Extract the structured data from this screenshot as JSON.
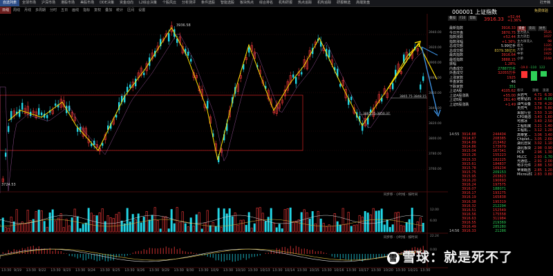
{
  "topbar": {
    "tabs": [
      "自选列表",
      "全球市场",
      "沪深市场",
      "港股市场",
      "美股市场",
      "DDE决策",
      "资金动向",
      "L2综合决策",
      "个股风云",
      "分析测评",
      "条件选股",
      "智能选股",
      "板块热点",
      "综合排名",
      "机构研报",
      "热点追踪",
      "机构追踪",
      "研报精选",
      "高端复盘"
    ],
    "active": 0,
    "open_label": "打开档"
  },
  "toolbar": {
    "items": [
      "日线",
      "周线",
      "月线",
      "多周期",
      "分时",
      "五日",
      "画线",
      "指标",
      "复权",
      "叠加",
      "统计",
      "区间",
      "设置"
    ],
    "selected": 0,
    "right_label": "设置"
  },
  "chart": {
    "high_label": "3936.58",
    "low_label": "3724.53",
    "ann1": "3865.75-3848.15",
    "ann2": "3865.75-3850.37",
    "y_ticks": [
      "3940.00",
      "3920.00",
      "3900.00",
      "3880.00",
      "3860.00",
      "3840.00",
      "3820.00",
      "3800.00",
      "3780.00",
      "3760.00"
    ],
    "vol_ticks": [
      "12.00",
      "6.00"
    ],
    "macd_ticks": [
      "22.24",
      "0.00"
    ],
    "x_ticks": [
      "13:30",
      "9/19",
      "13:30",
      "9/22",
      "13:30",
      "9/23",
      "13:30",
      "9/24",
      "13:30",
      "9/25",
      "13:30",
      "9/26",
      "13:30",
      "9/29",
      "13:30",
      "9/30",
      "13:30",
      "10/9",
      "13:30",
      "10/10",
      "13:30",
      "10/13",
      "13:30",
      "10/14",
      "13:30",
      "10/15",
      "13:30",
      "10/16",
      "13:30",
      "10/17",
      "13:30",
      "10/20",
      "13:30",
      "10/21",
      "13:30"
    ],
    "panel_menu": "同步移 · 小时线 · 按时间",
    "vol_menu": "同步移 · 小时线 · 按时间",
    "colors": {
      "up": "#ff3b3b",
      "down": "#22d6e6",
      "zigzag": "#ffe100",
      "blue_arrow": "#3b8fe0"
    }
  },
  "quote": {
    "code": "000001",
    "name": "上证指数",
    "alt": "免费体验",
    "price": "3916.33",
    "change": "+52.44",
    "change_pct": "+1.36%",
    "buttons": [
      "叠加",
      "F10",
      "帮助"
    ],
    "stats": [
      {
        "k": "最新指数",
        "v": "3916.33",
        "c": "r"
      },
      {
        "k": "今日开盘",
        "v": "3870.75",
        "c": "r"
      },
      {
        "k": "指数涨跌",
        "v": "+52.44",
        "c": "r"
      },
      {
        "k": "指数涨幅",
        "v": "+1.36%",
        "c": "r"
      },
      {
        "k": "总成交额",
        "v": "5.99亿手",
        "c": "w"
      },
      {
        "k": "总成交额",
        "v": "8379.38亿元",
        "c": "y"
      },
      {
        "k": "最高指数",
        "v": "3916.64",
        "c": "r"
      },
      {
        "k": "最低指数",
        "v": "3888.15",
        "c": "r"
      },
      {
        "k": "振幅",
        "v": "1.28%",
        "c": "r"
      },
      {
        "k": "内盘成交",
        "v": "27887万手",
        "c": "g"
      },
      {
        "k": "外盘成交",
        "v": "32055万手",
        "c": "r"
      },
      {
        "k": "上涨家数",
        "v": "1925",
        "c": "r"
      },
      {
        "k": "平盘家数",
        "v": "46",
        "c": "w"
      },
      {
        "k": "下跌家数",
        "v": "351",
        "c": "g"
      },
      {
        "k": "上证A股",
        "v": "4105.62",
        "c": "r"
      },
      {
        "k": "上证A股涨跌",
        "v": "+55.00",
        "c": "r"
      },
      {
        "k": "上证B股",
        "v": "261.40",
        "c": "r"
      },
      {
        "k": "上证B股涨跌",
        "v": "+1.49",
        "c": "r"
      }
    ],
    "ticks": [
      {
        "t": "14:55",
        "p": "3914.88",
        "v": "244404",
        "c": "r"
      },
      {
        "t": "",
        "p": "3914.87",
        "v": "208385",
        "c": "r"
      },
      {
        "t": "",
        "p": "3914.89",
        "v": "213462",
        "c": "r"
      },
      {
        "t": "",
        "p": "3914.86",
        "v": "173679",
        "c": "r"
      },
      {
        "t": "",
        "p": "3915.04",
        "v": "167341",
        "c": "r"
      },
      {
        "t": "",
        "p": "3915.26",
        "v": "155223",
        "c": "r"
      },
      {
        "t": "",
        "p": "3915.33",
        "v": "182225",
        "c": "r"
      },
      {
        "t": "",
        "p": "3915.61",
        "v": "184837",
        "c": "r"
      },
      {
        "t": "",
        "p": "3915.78",
        "v": "169234",
        "c": "r"
      },
      {
        "t": "",
        "p": "3915.75",
        "v": "209153",
        "c": "g"
      },
      {
        "t": "",
        "p": "3915.95",
        "v": "203823",
        "c": "r"
      },
      {
        "t": "",
        "p": "3916.20",
        "v": "190693",
        "c": "r"
      },
      {
        "t": "",
        "p": "3916.24",
        "v": "197575",
        "c": "r"
      },
      {
        "t": "",
        "p": "3916.07",
        "v": "188071",
        "c": "g"
      },
      {
        "t": "",
        "p": "3916.17",
        "v": "193275",
        "c": "r"
      },
      {
        "t": "",
        "p": "3916.19",
        "v": "165838",
        "c": "r"
      },
      {
        "t": "",
        "p": "3916.38",
        "v": "195319",
        "c": "r"
      },
      {
        "t": "",
        "p": "3916.32",
        "v": "212294",
        "c": "g"
      },
      {
        "t": "",
        "p": "3916.51",
        "v": "152549",
        "c": "r"
      },
      {
        "t": "",
        "p": "3916.56",
        "v": "175558",
        "c": "r"
      },
      {
        "t": "",
        "p": "3916.63",
        "v": "311984",
        "c": "r"
      },
      {
        "t": "",
        "p": "3916.55",
        "v": "219369",
        "c": "g"
      },
      {
        "t": "",
        "p": "3916.49",
        "v": "285280",
        "c": "g"
      },
      {
        "t": "14:56",
        "p": "3916.33",
        "v": "21286",
        "c": "g"
      }
    ]
  },
  "sidecol": {
    "tabs": [
      "资金",
      "资讯",
      "财务"
    ],
    "rows": [
      {
        "k": "主力流入",
        "v": "3535"
      },
      {
        "k": "主力流出",
        "v": "3437"
      },
      {
        "k": "主力净流入",
        "v": "98"
      },
      {
        "k": "超大",
        "v": "1335"
      },
      {
        "k": "大单",
        "v": "2248"
      },
      {
        "k": "中单",
        "v": "1925"
      },
      {
        "k": "小单",
        "v": "2168"
      }
    ],
    "bar_vals": [
      "-19.0",
      "-110",
      "122"
    ],
    "sector_head": [
      "板块",
      "涨幅",
      "涨速"
    ],
    "sectors": [
      {
        "n": "页岩气",
        "a": "4.71",
        "b": "6.30",
        "c": "r"
      },
      {
        "n": "培育钻石",
        "a": "4.18",
        "b": "-4.00",
        "c": "g"
      },
      {
        "n": "油气设备",
        "a": "3.78",
        "b": "4.20",
        "c": "r"
      },
      {
        "n": "天然气",
        "a": "3.54",
        "b": "5.80",
        "c": "r"
      },
      {
        "n": "采掘行业",
        "a": "3.50",
        "b": "3.10",
        "c": "r"
      },
      {
        "n": "CPO概念",
        "a": "3.43",
        "b": "1.60",
        "c": "r"
      },
      {
        "n": "可燃冰",
        "a": "3.40",
        "b": "2.50",
        "c": "r"
      },
      {
        "n": "工程机械",
        "a": "3.21",
        "b": "1.40",
        "c": "r"
      },
      {
        "n": "工程机...",
        "a": "3.12",
        "b": "1.20",
        "c": "r"
      },
      {
        "n": "高带宽...",
        "a": "3.06",
        "b": "3.40",
        "c": "r"
      },
      {
        "n": "Chiplet...",
        "a": "3.05",
        "b": "2.60",
        "c": "r"
      },
      {
        "n": "湖北自贸",
        "a": "3.02",
        "b": "1.10",
        "c": "r"
      },
      {
        "n": "湖北板块",
        "a": "2.98",
        "b": "0.90",
        "c": "r"
      },
      {
        "n": "PCB",
        "a": "2.96",
        "b": "1.30",
        "c": "r"
      },
      {
        "n": "MLCC",
        "a": "2.93",
        "b": "-1.70",
        "c": "g"
      },
      {
        "n": "光通信...",
        "a": "2.91",
        "b": "2.00",
        "c": "r"
      },
      {
        "n": "电子元件",
        "a": "2.88",
        "b": "1.50",
        "c": "r"
      },
      {
        "n": "苹果概念",
        "a": "2.85",
        "b": "1.20",
        "c": "r"
      },
      {
        "n": "MicroLED",
        "a": "2.83",
        "b": "0.80",
        "c": "r"
      }
    ]
  },
  "watermark": {
    "icon": "雪",
    "text": "雪球：就是死不了"
  }
}
